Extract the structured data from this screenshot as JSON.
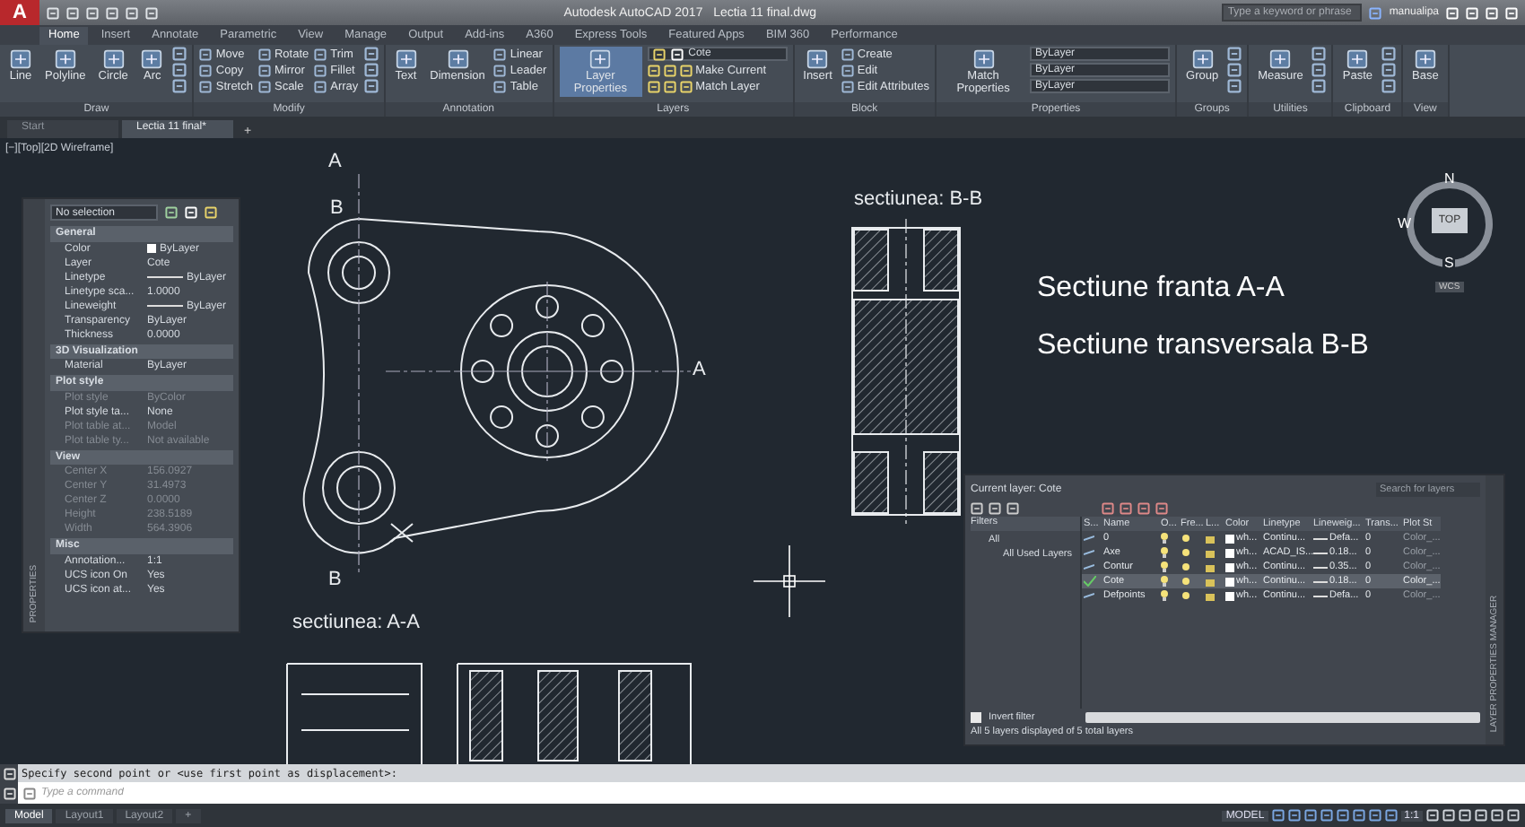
{
  "title_bar": {
    "app_letter": "A",
    "title": "Autodesk AutoCAD 2017",
    "file": "Lectia 11 final.dwg",
    "search": {
      "placeholder": "Type a keyword or phrase"
    },
    "user": "manualipa"
  },
  "ribbon_tabs": [
    {
      "label": "Home",
      "selected": true
    },
    {
      "label": "Insert",
      "selected": false
    },
    {
      "label": "Annotate",
      "selected": false
    },
    {
      "label": "Parametric",
      "selected": false
    },
    {
      "label": "View",
      "selected": false
    },
    {
      "label": "Manage",
      "selected": false
    },
    {
      "label": "Output",
      "selected": false
    },
    {
      "label": "Add-ins",
      "selected": false
    },
    {
      "label": "A360",
      "selected": false
    },
    {
      "label": "Express Tools",
      "selected": false
    },
    {
      "label": "Featured Apps",
      "selected": false
    },
    {
      "label": "BIM 360",
      "selected": false
    },
    {
      "label": "Performance",
      "selected": false
    }
  ],
  "ribbon_panels": [
    {
      "title": "Draw",
      "items": [
        {
          "kind": "large",
          "label": "Line"
        },
        {
          "kind": "large",
          "label": "Polyline"
        },
        {
          "kind": "large",
          "label": "Circle"
        },
        {
          "kind": "large",
          "label": "Arc"
        },
        {
          "kind": "icon_column"
        }
      ]
    },
    {
      "title": "Modify",
      "items": [
        {
          "kind": "column",
          "labels": [
            "Move",
            "Copy",
            "Stretch"
          ]
        },
        {
          "kind": "column",
          "labels": [
            "Rotate",
            "Mirror",
            "Scale"
          ]
        },
        {
          "kind": "column",
          "labels": [
            "Trim",
            "Fillet",
            "Array"
          ]
        },
        {
          "kind": "icon_column"
        }
      ]
    },
    {
      "title": "Annotation",
      "items": [
        {
          "kind": "large",
          "label": "Text"
        },
        {
          "kind": "large",
          "label": "Dimension"
        },
        {
          "kind": "column",
          "labels": [
            "Linear",
            "Leader",
            "Table"
          ]
        }
      ]
    },
    {
      "title": "Layers",
      "items": [
        {
          "kind": "large",
          "label": "Layer Properties",
          "selected": true
        },
        {
          "kind": "layer_block",
          "layer": "Cote",
          "labels": [
            "Make Current",
            "Match Layer"
          ]
        }
      ]
    },
    {
      "title": "Block",
      "items": [
        {
          "kind": "large",
          "label": "Insert"
        },
        {
          "kind": "column",
          "labels": [
            "Create",
            "Edit",
            "Edit Attributes"
          ]
        }
      ]
    },
    {
      "title": "Properties",
      "items": [
        {
          "kind": "large",
          "label": "Match Properties"
        },
        {
          "kind": "dropdowns",
          "values": [
            "ByLayer",
            "ByLayer",
            "ByLayer"
          ]
        }
      ]
    },
    {
      "title": "Groups",
      "items": [
        {
          "kind": "large",
          "label": "Group"
        },
        {
          "kind": "icon_column"
        }
      ]
    },
    {
      "title": "Utilities",
      "items": [
        {
          "kind": "large",
          "label": "Measure"
        },
        {
          "kind": "icon_column"
        }
      ]
    },
    {
      "title": "Clipboard",
      "items": [
        {
          "kind": "large",
          "label": "Paste"
        },
        {
          "kind": "icon_column"
        }
      ]
    },
    {
      "title": "View",
      "items": [
        {
          "kind": "large",
          "label": "Base"
        }
      ]
    }
  ],
  "file_tabs": [
    {
      "label": "Start",
      "selected": false
    },
    {
      "label": "Lectia 11 final*",
      "selected": true
    }
  ],
  "new_tab": "+",
  "viewport_label": "[−][Top][2D Wireframe]",
  "drawing": {
    "front_view_labels": [
      "A",
      "B",
      "B"
    ],
    "section_a_mark": "A",
    "section_b_title": "sectiunea: B-B",
    "section_a_title": "sectiunea: A-A",
    "notes": [
      "Sectiune franta A-A",
      "Sectiune transversala B-B"
    ]
  },
  "view_cube": {
    "north": "N",
    "west": "W",
    "face": "TOP",
    "south": "S",
    "ucs": "WCS"
  },
  "properties_palette": {
    "title": "PROPERTIES",
    "selection": "No selection",
    "sections": [
      {
        "title": "General",
        "rows": [
          {
            "label": "Color",
            "value": "ByLayer",
            "kind": "swatch",
            "disabled": false
          },
          {
            "label": "Layer",
            "value": "Cote",
            "kind": "text",
            "disabled": false
          },
          {
            "label": "Linetype",
            "value": "ByLayer",
            "kind": "line",
            "disabled": false
          },
          {
            "label": "Linetype sca...",
            "value": "1.0000",
            "kind": "text",
            "disabled": false
          },
          {
            "label": "Lineweight",
            "value": "ByLayer",
            "kind": "line",
            "disabled": false
          },
          {
            "label": "Transparency",
            "value": "ByLayer",
            "kind": "text",
            "disabled": false
          },
          {
            "label": "Thickness",
            "value": "0.0000",
            "kind": "text",
            "disabled": false
          }
        ]
      },
      {
        "title": "3D Visualization",
        "rows": [
          {
            "label": "Material",
            "value": "ByLayer",
            "kind": "text",
            "disabled": false
          }
        ]
      },
      {
        "title": "Plot style",
        "rows": [
          {
            "label": "Plot style",
            "value": "ByColor",
            "kind": "text",
            "disabled": true
          },
          {
            "label": "Plot style ta...",
            "value": "None",
            "kind": "text",
            "disabled": false
          },
          {
            "label": "Plot table at...",
            "value": "Model",
            "kind": "text",
            "disabled": true
          },
          {
            "label": "Plot table ty...",
            "value": "Not available",
            "kind": "text",
            "disabled": true
          }
        ]
      },
      {
        "title": "View",
        "rows": [
          {
            "label": "Center X",
            "value": "156.0927",
            "kind": "text",
            "disabled": true
          },
          {
            "label": "Center Y",
            "value": "31.4973",
            "kind": "text",
            "disabled": true
          },
          {
            "label": "Center Z",
            "value": "0.0000",
            "kind": "text",
            "disabled": true
          },
          {
            "label": "Height",
            "value": "238.5189",
            "kind": "text",
            "disabled": true
          },
          {
            "label": "Width",
            "value": "564.3906",
            "kind": "text",
            "disabled": true
          }
        ]
      },
      {
        "title": "Misc",
        "rows": [
          {
            "label": "Annotation...",
            "value": "1:1",
            "kind": "text",
            "disabled": false
          },
          {
            "label": "UCS icon On",
            "value": "Yes",
            "kind": "text",
            "disabled": false
          },
          {
            "label": "UCS icon at...",
            "value": "Yes",
            "kind": "text",
            "disabled": false
          }
        ]
      }
    ]
  },
  "layer_manager": {
    "title": "LAYER PROPERTIES MANAGER",
    "current_layer": "Current layer: Cote",
    "search": {
      "placeholder": "Search for layers"
    },
    "filters_label": "Filters",
    "filter_tree": {
      "label": "All",
      "children": [
        {
          "label": "All Used Layers"
        }
      ]
    },
    "columns": [
      "S...",
      "Name",
      "O...",
      "Fre...",
      "L...",
      "Color",
      "Linetype",
      "Lineweig...",
      "Trans...",
      "Plot St"
    ],
    "rows": [
      {
        "name": "0",
        "color_name": "wh...",
        "linetype": "Continu...",
        "lineweight": "Defa...",
        "transparency": "0",
        "plot_style": "Color_...",
        "current": false,
        "selected": false
      },
      {
        "name": "Axe",
        "color_name": "wh...",
        "linetype": "ACAD_IS...",
        "lineweight": "0.18...",
        "transparency": "0",
        "plot_style": "Color_...",
        "current": false,
        "selected": false
      },
      {
        "name": "Contur",
        "color_name": "wh...",
        "linetype": "Continu...",
        "lineweight": "0.35...",
        "transparency": "0",
        "plot_style": "Color_...",
        "current": false,
        "selected": false
      },
      {
        "name": "Cote",
        "color_name": "wh...",
        "linetype": "Continu...",
        "lineweight": "0.18...",
        "transparency": "0",
        "plot_style": "Color_...",
        "current": true,
        "selected": true
      },
      {
        "name": "Defpoints",
        "color_name": "wh...",
        "linetype": "Continu...",
        "lineweight": "Defa...",
        "transparency": "0",
        "plot_style": "Color_...",
        "current": false,
        "selected": false
      }
    ],
    "invert_filter": {
      "label": "Invert filter",
      "checked": false
    },
    "footer": "All 5 layers displayed of 5 total layers"
  },
  "command_line": {
    "history": "Specify second point or <use first point as displacement>:",
    "placeholder": "Type a command"
  },
  "layout_tabs": [
    {
      "label": "Model",
      "selected": true
    },
    {
      "label": "Layout1",
      "selected": false
    },
    {
      "label": "Layout2",
      "selected": false
    }
  ],
  "new_layout": "+",
  "status_bar": {
    "space": "MODEL",
    "scale": "1:1"
  }
}
